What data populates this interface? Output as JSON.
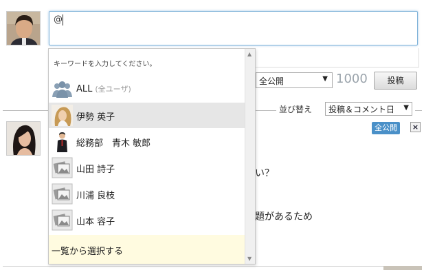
{
  "compose": {
    "value": "@"
  },
  "visibility_select": {
    "value": "全公開"
  },
  "char_count": "1000",
  "post_button_label": "投稿",
  "sort": {
    "label": "並び替え",
    "value": "投稿＆コメント日"
  },
  "feed_item": {
    "visibility_badge": "全公開",
    "close_label": "×",
    "text_fragment_1": "い？",
    "text_fragment_2": "題題があるため"
  },
  "mention_dropdown": {
    "hint": "キーワードを入力してください。",
    "items": [
      {
        "label": "ALL",
        "sub": "(全ユーザ)",
        "icon": "group-icon"
      },
      {
        "label": "伊勢 英子",
        "icon": "user-photo-icon",
        "selected": true
      },
      {
        "label": "総務部　青木 敏郎",
        "icon": "user-photo-icon"
      },
      {
        "label": "山田 詩子",
        "icon": "no-photo-icon"
      },
      {
        "label": "川浦 良枝",
        "icon": "no-photo-icon"
      },
      {
        "label": "山本 容子",
        "icon": "no-photo-icon"
      }
    ],
    "footer": "一覧から選択する"
  },
  "colors": {
    "badge_blue": "#4a90c8",
    "selected_row": "#e6e6e6",
    "footer_bg": "#fffbe0",
    "focus_border": "#7fb3d9"
  }
}
